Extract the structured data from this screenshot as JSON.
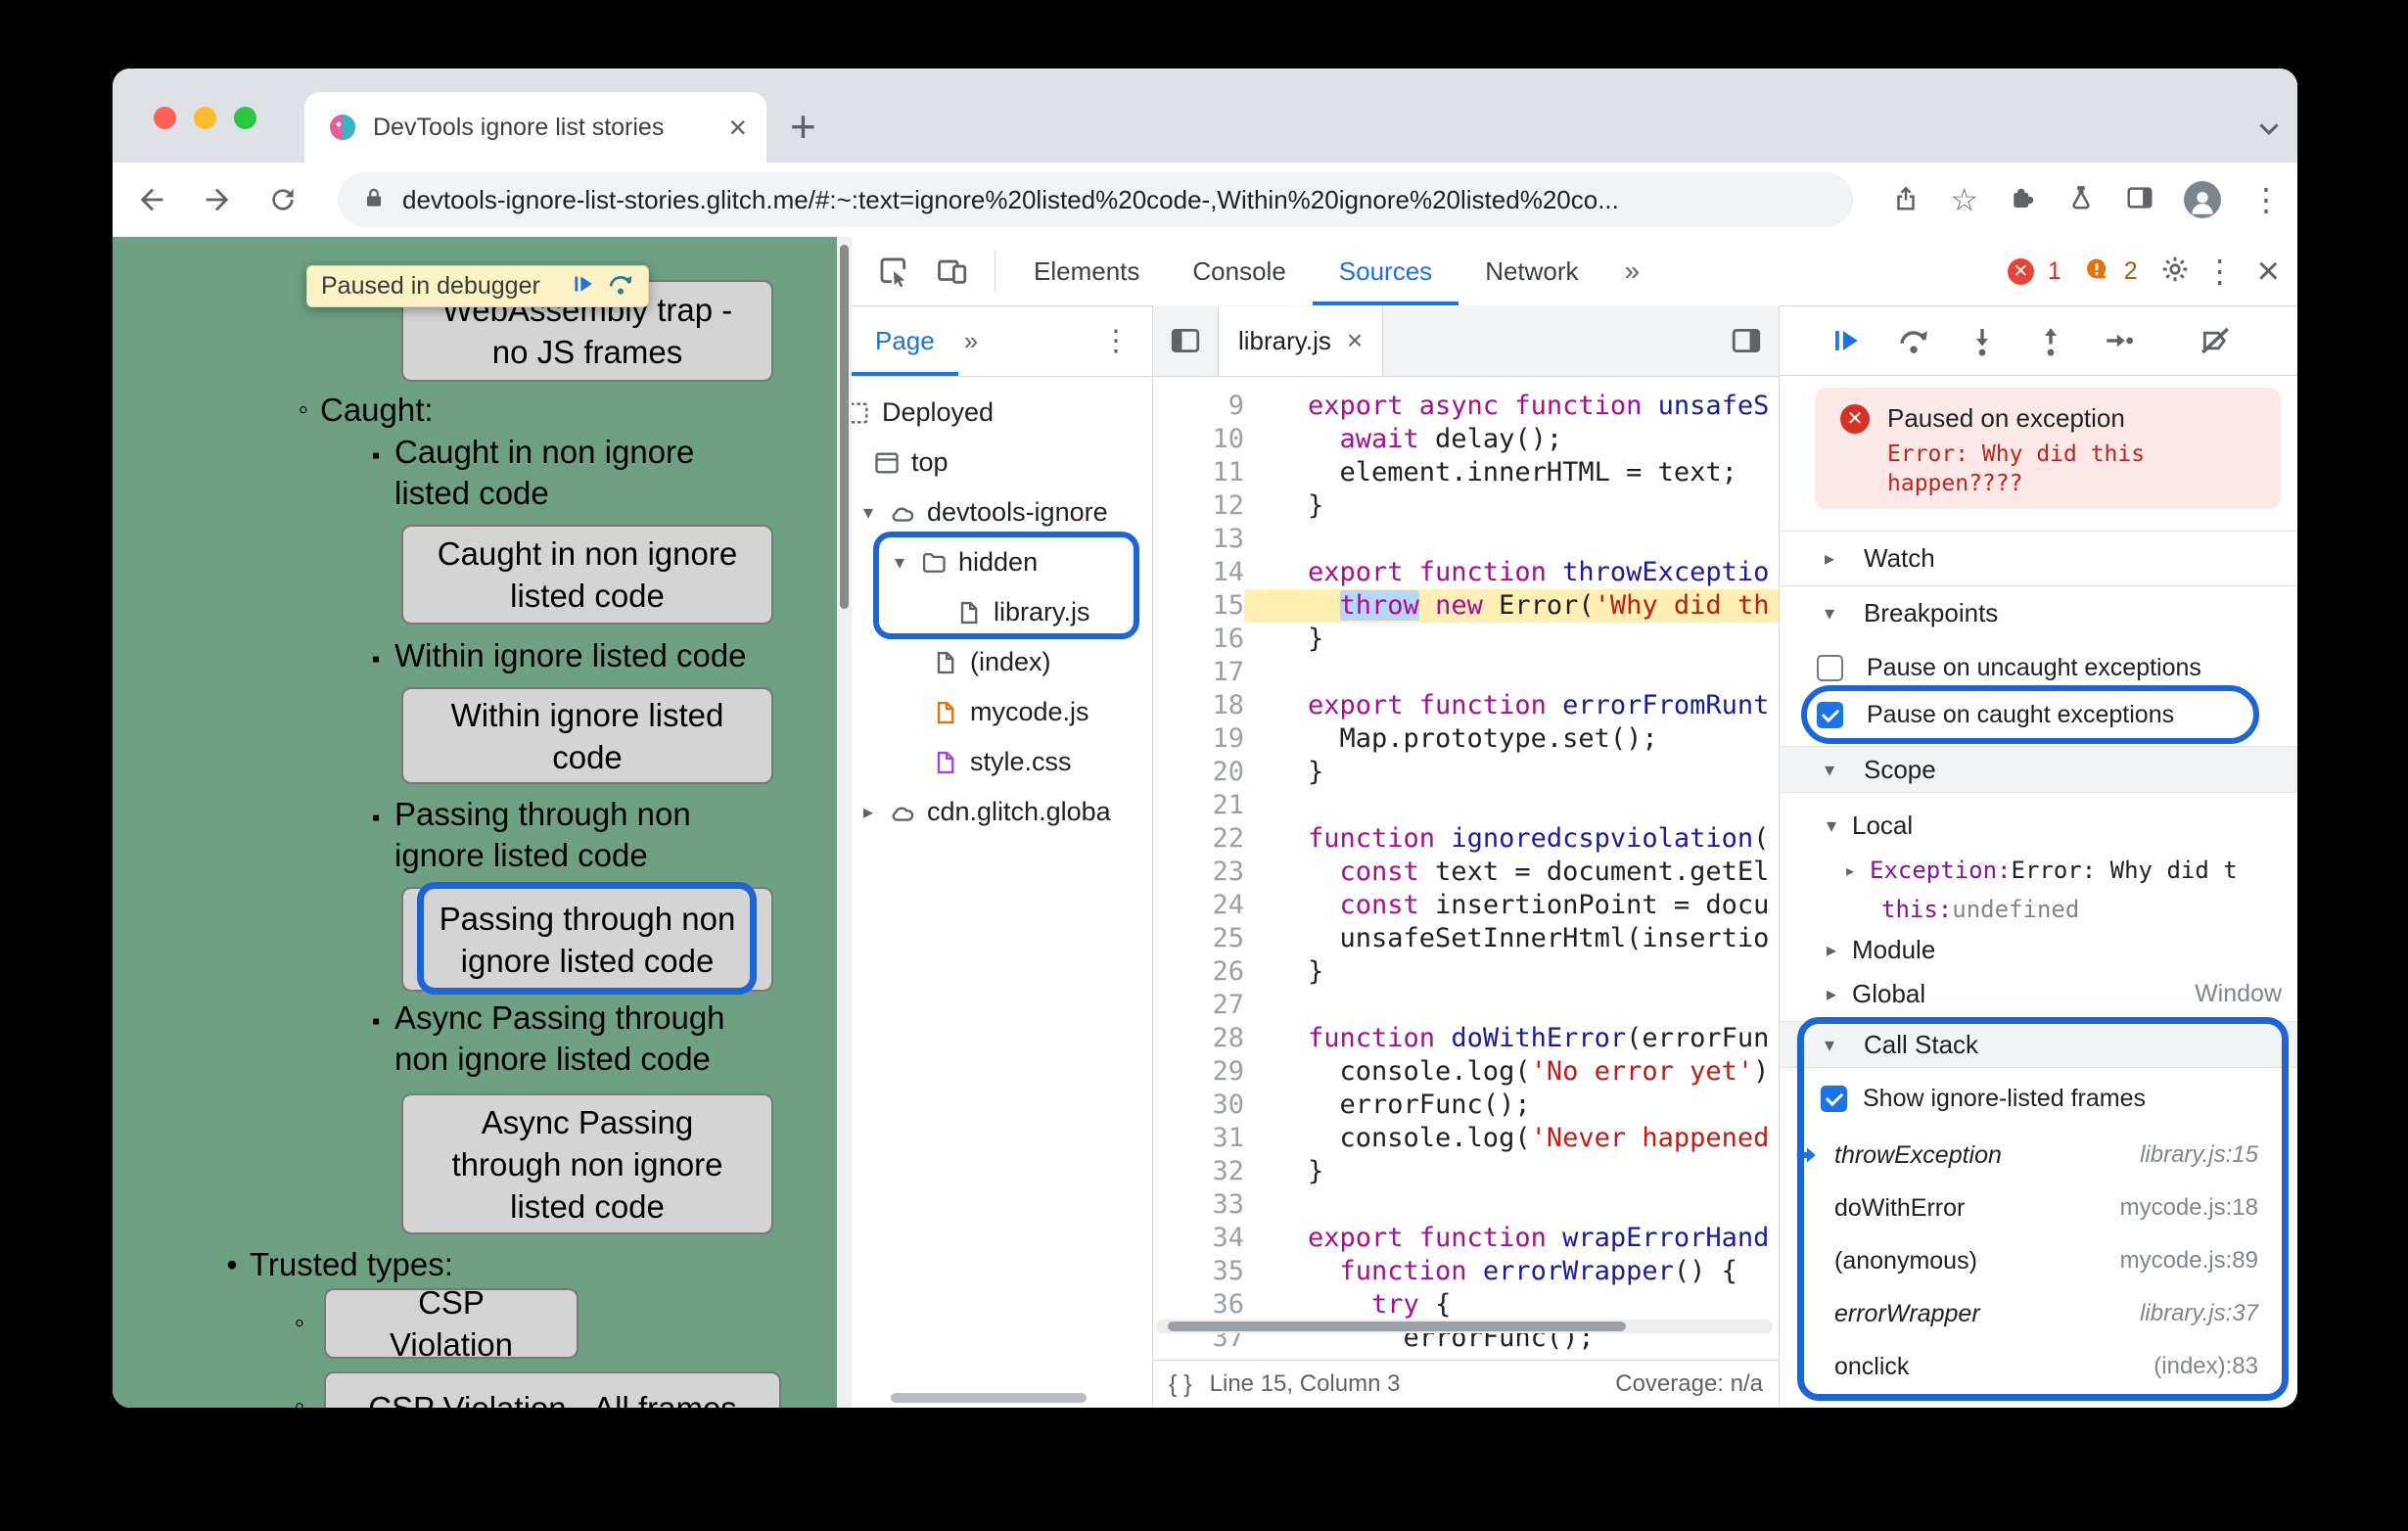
{
  "window": {
    "tab_title": "DevTools ignore list stories",
    "tab_close": "×",
    "new_tab": "+",
    "url": "devtools-ignore-list-stories.glitch.me/#:~:text=ignore%20listed%20code-,Within%20ignore%20listed%20co...",
    "menu": "⋮"
  },
  "page": {
    "bullets": {
      "disc": "•",
      "circle": "◦",
      "square": "▪"
    },
    "paused_tooltip": "Paused in debugger",
    "wasm_button": "WebAssembly trap - no JS frames",
    "caught_heading": "Caught:",
    "items": [
      {
        "text": "Caught in non ignore listed code",
        "button": "Caught in non ignore listed code"
      },
      {
        "text": "Within ignore listed code",
        "button": "Within ignore listed code"
      },
      {
        "text": "Passing through non ignore listed code",
        "button": "Passing through non ignore listed code"
      },
      {
        "text": "Async Passing through non ignore listed code",
        "button": "Async Passing through non ignore listed code"
      }
    ],
    "trusted_heading": "Trusted types:",
    "csp_items": [
      {
        "button": "CSP Violation"
      },
      {
        "button": "CSP Violation - All frames"
      }
    ]
  },
  "devtools": {
    "tabs": [
      "Elements",
      "Console",
      "Sources",
      "Network"
    ],
    "selected_tab": "Sources",
    "more_tabs": "»",
    "error_count": "1",
    "issue_count": "2",
    "close": "×",
    "menu": "⋮",
    "navigator": {
      "tab": "Page",
      "more": "»",
      "menu": "⋮",
      "tree": [
        {
          "label": "Deployed",
          "icon": "group",
          "open": null
        },
        {
          "label": "top",
          "icon": "frame",
          "open": null
        },
        {
          "label": "devtools-ignore",
          "icon": "cloud",
          "open": "down"
        },
        {
          "label": "hidden",
          "icon": "folder",
          "open": "down"
        },
        {
          "label": "library.js",
          "icon": "file",
          "open": null
        },
        {
          "label": "(index)",
          "icon": "file",
          "open": null
        },
        {
          "label": "mycode.js",
          "icon": "file",
          "open": null,
          "icon_color": "#e8710a"
        },
        {
          "label": "style.css",
          "icon": "file",
          "open": null,
          "icon_color": "#a142f4"
        },
        {
          "label": "cdn.glitch.globa",
          "icon": "cloud",
          "open": "right"
        }
      ]
    },
    "editor": {
      "tab": "library.js",
      "tab_close": "×",
      "lines": [
        {
          "n": 9,
          "toks": [
            [
              "kw",
              "export async function "
            ],
            [
              "fn",
              "unsafeS"
            ]
          ]
        },
        {
          "n": 10,
          "toks": [
            [
              "pl",
              "  "
            ],
            [
              "kw",
              "await"
            ],
            [
              "pl",
              " delay();"
            ]
          ]
        },
        {
          "n": 11,
          "toks": [
            [
              "pl",
              "  element.innerHTML = text;"
            ]
          ]
        },
        {
          "n": 12,
          "toks": [
            [
              "pl",
              "}"
            ]
          ]
        },
        {
          "n": 13,
          "toks": []
        },
        {
          "n": 14,
          "toks": [
            [
              "kw",
              "export function "
            ],
            [
              "fn",
              "throwExceptio"
            ]
          ]
        },
        {
          "n": 15,
          "paused": true,
          "toks": [
            [
              "pl",
              "  "
            ],
            [
              "kwsel",
              "throw"
            ],
            [
              "pl",
              " "
            ],
            [
              "kw",
              "new"
            ],
            [
              "pl",
              " Error("
            ],
            [
              "str",
              "'Why did th"
            ]
          ]
        },
        {
          "n": 16,
          "toks": [
            [
              "pl",
              "}"
            ]
          ]
        },
        {
          "n": 17,
          "toks": []
        },
        {
          "n": 18,
          "toks": [
            [
              "kw",
              "export function "
            ],
            [
              "fn",
              "errorFromRunt"
            ]
          ]
        },
        {
          "n": 19,
          "toks": [
            [
              "pl",
              "  Map.prototype.set();"
            ]
          ]
        },
        {
          "n": 20,
          "toks": [
            [
              "pl",
              "}"
            ]
          ]
        },
        {
          "n": 21,
          "toks": []
        },
        {
          "n": 22,
          "toks": [
            [
              "kw",
              "function "
            ],
            [
              "fn",
              "ignoredcspviolation"
            ],
            [
              "pl",
              "("
            ]
          ]
        },
        {
          "n": 23,
          "toks": [
            [
              "pl",
              "  "
            ],
            [
              "kw",
              "const"
            ],
            [
              "pl",
              " text = document.getEl"
            ]
          ]
        },
        {
          "n": 24,
          "toks": [
            [
              "pl",
              "  "
            ],
            [
              "kw",
              "const"
            ],
            [
              "pl",
              " insertionPoint = docu"
            ]
          ]
        },
        {
          "n": 25,
          "toks": [
            [
              "pl",
              "  unsafeSetInnerHtml(insertio"
            ]
          ]
        },
        {
          "n": 26,
          "toks": [
            [
              "pl",
              "}"
            ]
          ]
        },
        {
          "n": 27,
          "toks": []
        },
        {
          "n": 28,
          "toks": [
            [
              "kw",
              "function "
            ],
            [
              "fn",
              "doWithError"
            ],
            [
              "pl",
              "(errorFun"
            ]
          ]
        },
        {
          "n": 29,
          "toks": [
            [
              "pl",
              "  console.log("
            ],
            [
              "str",
              "'No error yet'"
            ],
            [
              "pl",
              ")"
            ]
          ]
        },
        {
          "n": 30,
          "toks": [
            [
              "pl",
              "  errorFunc();"
            ]
          ]
        },
        {
          "n": 31,
          "toks": [
            [
              "pl",
              "  console.log("
            ],
            [
              "str",
              "'Never happened"
            ]
          ]
        },
        {
          "n": 32,
          "toks": [
            [
              "pl",
              "}"
            ]
          ]
        },
        {
          "n": 33,
          "toks": []
        },
        {
          "n": 34,
          "toks": [
            [
              "kw",
              "export function "
            ],
            [
              "fn",
              "wrapErrorHand"
            ]
          ]
        },
        {
          "n": 35,
          "toks": [
            [
              "pl",
              "  "
            ],
            [
              "kw",
              "function "
            ],
            [
              "fn",
              "errorWrapper"
            ],
            [
              "pl",
              "() {"
            ]
          ]
        },
        {
          "n": 36,
          "toks": [
            [
              "pl",
              "    "
            ],
            [
              "kw",
              "try"
            ],
            [
              "pl",
              " {"
            ]
          ]
        },
        {
          "n": 37,
          "toks": [
            [
              "pl",
              "      errorFunc();"
            ]
          ]
        }
      ],
      "status": {
        "brackets": "{ }",
        "line_col": "Line 15, Column 3",
        "coverage": "Coverage: n/a"
      }
    },
    "debugger": {
      "paused_title": "Paused on exception",
      "paused_message": "Error: Why did this happen????",
      "sections": {
        "watch": "Watch",
        "breakpoints": "Breakpoints",
        "scope": "Scope",
        "call_stack": "Call Stack"
      },
      "breakpoints": [
        {
          "label": "Pause on uncaught exceptions",
          "checked": false
        },
        {
          "label": "Pause on caught exceptions",
          "checked": true
        }
      ],
      "scope": {
        "local_label": "Local",
        "exception_label": "Exception: ",
        "exception_value": "Error: Why did t",
        "this_label": "this: ",
        "this_value": "undefined",
        "module_label": "Module",
        "global_label": "Global",
        "global_value": "Window"
      },
      "show_ignore_label": "Show ignore-listed frames",
      "frames": [
        {
          "name": "throwException",
          "loc": "library.js:15",
          "italic": true,
          "current": true
        },
        {
          "name": "doWithError",
          "loc": "mycode.js:18",
          "italic": false,
          "current": false
        },
        {
          "name": "(anonymous)",
          "loc": "mycode.js:89",
          "italic": false,
          "current": false
        },
        {
          "name": "errorWrapper",
          "loc": "library.js:37",
          "italic": true,
          "current": false
        },
        {
          "name": "onclick",
          "loc": "(index):83",
          "italic": false,
          "current": false
        }
      ]
    }
  }
}
